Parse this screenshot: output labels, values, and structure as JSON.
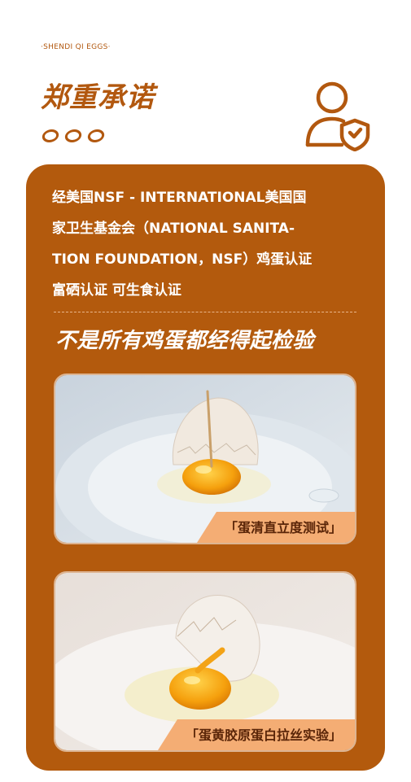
{
  "header": {
    "brand_tag": "·SHENDI QI EGGS·",
    "title": "郑重承诺"
  },
  "card": {
    "intro_lines": [
      "经美国NSF - INTERNATIONAL美国国",
      "家卫生基金会（NATIONAL SANITA-",
      "TION FOUNDATION，NSF）鸡蛋认证",
      "富硒认证 可生食认证"
    ],
    "slogan": "不是所有鸡蛋都经得起检验",
    "tests": [
      {
        "label": "「蛋清直立度测试」",
        "image": "egg-toothpick-test-photo"
      },
      {
        "label": "「蛋黄胶原蛋白拉丝实验」",
        "image": "egg-yolk-collagen-test-photo"
      }
    ]
  },
  "colors": {
    "brand": "#b2580f",
    "card_bg": "#b35a0d",
    "label_bg": "#f4ad74"
  },
  "icons": [
    "user-shield-icon"
  ]
}
